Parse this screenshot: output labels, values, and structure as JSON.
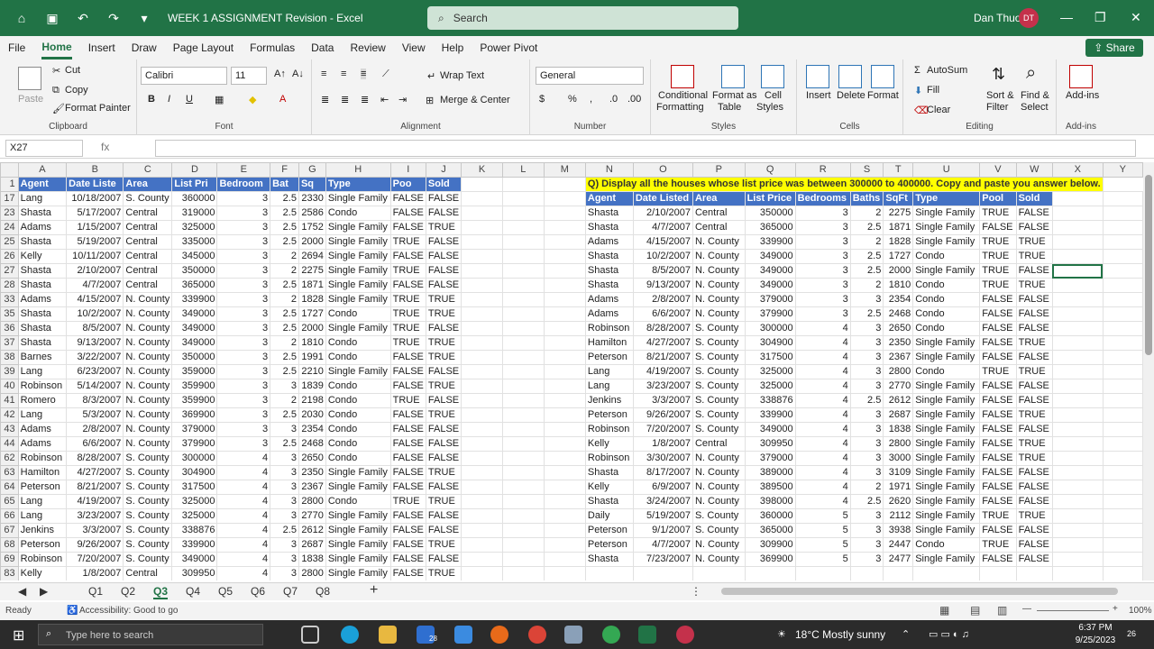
{
  "titlebar": {
    "doc_title": "WEEK 1 ASSIGNMENT Revision  -  Excel",
    "search_placeholder": "Search",
    "user_name": "Dan Thuo",
    "user_initials": "DT"
  },
  "menu": [
    "File",
    "Home",
    "Insert",
    "Draw",
    "Page Layout",
    "Formulas",
    "Data",
    "Review",
    "View",
    "Help",
    "Power Pivot"
  ],
  "share_label": "Share",
  "ribbon": {
    "clipboard": {
      "paste": "Paste",
      "cut": "Cut",
      "copy": "Copy",
      "format_painter": "Format Painter",
      "label": "Clipboard"
    },
    "font": {
      "name": "Calibri",
      "size": "11",
      "label": "Font"
    },
    "alignment": {
      "wrap": "Wrap Text",
      "merge": "Merge & Center",
      "label": "Alignment"
    },
    "number": {
      "format": "General",
      "label": "Number"
    },
    "styles": {
      "cond": "Conditional",
      "cond2": "Formatting",
      "fmt_table": "Format as",
      "fmt_table2": "Table",
      "cell_styles": "Cell",
      "cell_styles2": "Styles",
      "label": "Styles"
    },
    "cells": {
      "insert": "Insert",
      "delete": "Delete",
      "format": "Format",
      "label": "Cells"
    },
    "editing": {
      "autosum": "AutoSum",
      "fill": "Fill",
      "clear": "Clear",
      "sort": "Sort &",
      "sort2": "Filter",
      "find": "Find &",
      "find2": "Select",
      "label": "Editing"
    },
    "addins": {
      "btn": "Add-ins",
      "label": "Add-ins"
    }
  },
  "formula": {
    "name_box": "X27",
    "fx": "fx"
  },
  "columns": [
    "A",
    "B",
    "C",
    "D",
    "E",
    "F",
    "G",
    "H",
    "I",
    "J",
    "K",
    "L",
    "M",
    "N",
    "O",
    "P",
    "Q",
    "R",
    "S",
    "T",
    "U",
    "V",
    "W",
    "X",
    "Y"
  ],
  "left_headers": [
    "Agent",
    "Date Liste",
    "Area",
    "List Pri",
    "Bedroom",
    "Bat",
    "Sq",
    "Type",
    "Poo",
    "Sold"
  ],
  "right_headers": [
    "Agent",
    "Date Listed",
    "Area",
    "List Price",
    "Bedrooms",
    "Baths",
    "SqFt",
    "Type",
    "Pool",
    "Sold"
  ],
  "question": "Q) Display all the houses whose list price was between 300000 to 400000. Copy and paste you answer below.",
  "left_rows": [
    [
      "17",
      "Lang",
      "10/18/2007",
      "S. County",
      "360000",
      "3",
      "2.5",
      "2330",
      "Single Family",
      "FALSE",
      "FALSE"
    ],
    [
      "23",
      "Shasta",
      "5/17/2007",
      "Central",
      "319000",
      "3",
      "2.5",
      "2586",
      "Condo",
      "FALSE",
      "FALSE"
    ],
    [
      "24",
      "Adams",
      "1/15/2007",
      "Central",
      "325000",
      "3",
      "2.5",
      "1752",
      "Single Family",
      "FALSE",
      "TRUE"
    ],
    [
      "25",
      "Shasta",
      "5/19/2007",
      "Central",
      "335000",
      "3",
      "2.5",
      "2000",
      "Single Family",
      "TRUE",
      "FALSE"
    ],
    [
      "26",
      "Kelly",
      "10/11/2007",
      "Central",
      "345000",
      "3",
      "2",
      "2694",
      "Single Family",
      "FALSE",
      "FALSE"
    ],
    [
      "27",
      "Shasta",
      "2/10/2007",
      "Central",
      "350000",
      "3",
      "2",
      "2275",
      "Single Family",
      "TRUE",
      "FALSE"
    ],
    [
      "28",
      "Shasta",
      "4/7/2007",
      "Central",
      "365000",
      "3",
      "2.5",
      "1871",
      "Single Family",
      "FALSE",
      "FALSE"
    ],
    [
      "33",
      "Adams",
      "4/15/2007",
      "N. County",
      "339900",
      "3",
      "2",
      "1828",
      "Single Family",
      "TRUE",
      "TRUE"
    ],
    [
      "35",
      "Shasta",
      "10/2/2007",
      "N. County",
      "349000",
      "3",
      "2.5",
      "1727",
      "Condo",
      "TRUE",
      "TRUE"
    ],
    [
      "36",
      "Shasta",
      "8/5/2007",
      "N. County",
      "349000",
      "3",
      "2.5",
      "2000",
      "Single Family",
      "TRUE",
      "FALSE"
    ],
    [
      "37",
      "Shasta",
      "9/13/2007",
      "N. County",
      "349000",
      "3",
      "2",
      "1810",
      "Condo",
      "TRUE",
      "TRUE"
    ],
    [
      "38",
      "Barnes",
      "3/22/2007",
      "N. County",
      "350000",
      "3",
      "2.5",
      "1991",
      "Condo",
      "FALSE",
      "TRUE"
    ],
    [
      "39",
      "Lang",
      "6/23/2007",
      "N. County",
      "359000",
      "3",
      "2.5",
      "2210",
      "Single Family",
      "FALSE",
      "FALSE"
    ],
    [
      "40",
      "Robinson",
      "5/14/2007",
      "N. County",
      "359900",
      "3",
      "3",
      "1839",
      "Condo",
      "FALSE",
      "TRUE"
    ],
    [
      "41",
      "Romero",
      "8/3/2007",
      "N. County",
      "359900",
      "3",
      "2",
      "2198",
      "Condo",
      "TRUE",
      "FALSE"
    ],
    [
      "42",
      "Lang",
      "5/3/2007",
      "N. County",
      "369900",
      "3",
      "2.5",
      "2030",
      "Condo",
      "FALSE",
      "TRUE"
    ],
    [
      "43",
      "Adams",
      "2/8/2007",
      "N. County",
      "379000",
      "3",
      "3",
      "2354",
      "Condo",
      "FALSE",
      "FALSE"
    ],
    [
      "44",
      "Adams",
      "6/6/2007",
      "N. County",
      "379900",
      "3",
      "2.5",
      "2468",
      "Condo",
      "FALSE",
      "FALSE"
    ],
    [
      "62",
      "Robinson",
      "8/28/2007",
      "S. County",
      "300000",
      "4",
      "3",
      "2650",
      "Condo",
      "FALSE",
      "FALSE"
    ],
    [
      "63",
      "Hamilton",
      "4/27/2007",
      "S. County",
      "304900",
      "4",
      "3",
      "2350",
      "Single Family",
      "FALSE",
      "TRUE"
    ],
    [
      "64",
      "Peterson",
      "8/21/2007",
      "S. County",
      "317500",
      "4",
      "3",
      "2367",
      "Single Family",
      "FALSE",
      "FALSE"
    ],
    [
      "65",
      "Lang",
      "4/19/2007",
      "S. County",
      "325000",
      "4",
      "3",
      "2800",
      "Condo",
      "TRUE",
      "TRUE"
    ],
    [
      "66",
      "Lang",
      "3/23/2007",
      "S. County",
      "325000",
      "4",
      "3",
      "2770",
      "Single Family",
      "FALSE",
      "FALSE"
    ],
    [
      "67",
      "Jenkins",
      "3/3/2007",
      "S. County",
      "338876",
      "4",
      "2.5",
      "2612",
      "Single Family",
      "FALSE",
      "FALSE"
    ],
    [
      "68",
      "Peterson",
      "9/26/2007",
      "S. County",
      "339900",
      "4",
      "3",
      "2687",
      "Single Family",
      "FALSE",
      "TRUE"
    ],
    [
      "69",
      "Robinson",
      "7/20/2007",
      "S. County",
      "349000",
      "4",
      "3",
      "1838",
      "Single Family",
      "FALSE",
      "FALSE"
    ],
    [
      "83",
      "Kelly",
      "1/8/2007",
      "Central",
      "309950",
      "4",
      "3",
      "2800",
      "Single Family",
      "FALSE",
      "TRUE"
    ]
  ],
  "right_rows": [
    [
      "Shasta",
      "2/10/2007",
      "Central",
      "350000",
      "3",
      "2",
      "2275",
      "Single Family",
      "TRUE",
      "FALSE"
    ],
    [
      "Shasta",
      "4/7/2007",
      "Central",
      "365000",
      "3",
      "2.5",
      "1871",
      "Single Family",
      "FALSE",
      "FALSE"
    ],
    [
      "Adams",
      "4/15/2007",
      "N. County",
      "339900",
      "3",
      "2",
      "1828",
      "Single Family",
      "TRUE",
      "TRUE"
    ],
    [
      "Shasta",
      "10/2/2007",
      "N. County",
      "349000",
      "3",
      "2.5",
      "1727",
      "Condo",
      "TRUE",
      "TRUE"
    ],
    [
      "Shasta",
      "8/5/2007",
      "N. County",
      "349000",
      "3",
      "2.5",
      "2000",
      "Single Family",
      "TRUE",
      "FALSE"
    ],
    [
      "Shasta",
      "9/13/2007",
      "N. County",
      "349000",
      "3",
      "2",
      "1810",
      "Condo",
      "TRUE",
      "TRUE"
    ],
    [
      "Adams",
      "2/8/2007",
      "N. County",
      "379000",
      "3",
      "3",
      "2354",
      "Condo",
      "FALSE",
      "FALSE"
    ],
    [
      "Adams",
      "6/6/2007",
      "N. County",
      "379900",
      "3",
      "2.5",
      "2468",
      "Condo",
      "FALSE",
      "FALSE"
    ],
    [
      "Robinson",
      "8/28/2007",
      "S. County",
      "300000",
      "4",
      "3",
      "2650",
      "Condo",
      "FALSE",
      "FALSE"
    ],
    [
      "Hamilton",
      "4/27/2007",
      "S. County",
      "304900",
      "4",
      "3",
      "2350",
      "Single Family",
      "FALSE",
      "TRUE"
    ],
    [
      "Peterson",
      "8/21/2007",
      "S. County",
      "317500",
      "4",
      "3",
      "2367",
      "Single Family",
      "FALSE",
      "FALSE"
    ],
    [
      "Lang",
      "4/19/2007",
      "S. County",
      "325000",
      "4",
      "3",
      "2800",
      "Condo",
      "TRUE",
      "TRUE"
    ],
    [
      "Lang",
      "3/23/2007",
      "S. County",
      "325000",
      "4",
      "3",
      "2770",
      "Single Family",
      "FALSE",
      "FALSE"
    ],
    [
      "Jenkins",
      "3/3/2007",
      "S. County",
      "338876",
      "4",
      "2.5",
      "2612",
      "Single Family",
      "FALSE",
      "FALSE"
    ],
    [
      "Peterson",
      "9/26/2007",
      "S. County",
      "339900",
      "4",
      "3",
      "2687",
      "Single Family",
      "FALSE",
      "TRUE"
    ],
    [
      "Robinson",
      "7/20/2007",
      "S. County",
      "349000",
      "4",
      "3",
      "1838",
      "Single Family",
      "FALSE",
      "FALSE"
    ],
    [
      "Kelly",
      "1/8/2007",
      "Central",
      "309950",
      "4",
      "3",
      "2800",
      "Single Family",
      "FALSE",
      "TRUE"
    ],
    [
      "Robinson",
      "3/30/2007",
      "N. County",
      "379000",
      "4",
      "3",
      "3000",
      "Single Family",
      "FALSE",
      "TRUE"
    ],
    [
      "Shasta",
      "8/17/2007",
      "N. County",
      "389000",
      "4",
      "3",
      "3109",
      "Single Family",
      "FALSE",
      "FALSE"
    ],
    [
      "Kelly",
      "6/9/2007",
      "N. County",
      "389500",
      "4",
      "2",
      "1971",
      "Single Family",
      "FALSE",
      "FALSE"
    ],
    [
      "Shasta",
      "3/24/2007",
      "N. County",
      "398000",
      "4",
      "2.5",
      "2620",
      "Single Family",
      "FALSE",
      "FALSE"
    ],
    [
      "Daily",
      "5/19/2007",
      "S. County",
      "360000",
      "5",
      "3",
      "2112",
      "Single Family",
      "TRUE",
      "TRUE"
    ],
    [
      "Peterson",
      "9/1/2007",
      "S. County",
      "365000",
      "5",
      "3",
      "3938",
      "Single Family",
      "FALSE",
      "FALSE"
    ],
    [
      "Peterson",
      "4/7/2007",
      "N. County",
      "309900",
      "5",
      "3",
      "2447",
      "Condo",
      "TRUE",
      "FALSE"
    ],
    [
      "Shasta",
      "7/23/2007",
      "N. County",
      "369900",
      "5",
      "3",
      "2477",
      "Single Family",
      "FALSE",
      "FALSE"
    ]
  ],
  "tabs": [
    "Q1",
    "Q2",
    "Q3",
    "Q4",
    "Q5",
    "Q6",
    "Q7",
    "Q8"
  ],
  "active_tab": "Q3",
  "status": {
    "ready": "Ready",
    "accessibility": "Accessibility: Good to go",
    "zoom": "100%"
  },
  "taskbar": {
    "search": "Type here to search",
    "weather": "18°C  Mostly sunny",
    "time": "6:37 PM",
    "date": "9/25/2023",
    "badge": "28",
    "notif": "26"
  }
}
